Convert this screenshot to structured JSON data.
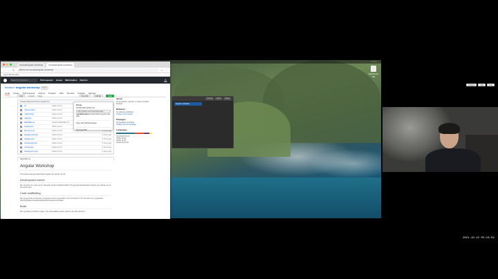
{
  "browser": {
    "tabs": [
      {
        "label": "tomiwa/angular-workshop"
      },
      {
        "label": "tomiwa/angular-workshop"
      }
    ],
    "url": "github.com/tomiwa/angular-workshop",
    "bookmarks": "Apps   Bookmarks"
  },
  "github": {
    "search_placeholder": "Search or jump to...",
    "nav": [
      "Pull requests",
      "Issues",
      "Marketplace",
      "Explore"
    ],
    "repo_owner": "tomiwa",
    "repo_name": "angular-workshop",
    "visibility": "Public",
    "tabs": [
      "Code",
      "Issues",
      "Pull requests",
      "Actions",
      "Projects",
      "Wiki",
      "Security",
      "Insights",
      "Settings"
    ],
    "actions": [
      "Unwatch",
      "Star",
      "Fork"
    ],
    "branch": "main",
    "branch_info": "1 branch",
    "tags_info": "0 tags",
    "goto_file": "Go to file",
    "add_file": "Add file",
    "code_button": "Code",
    "commit_message": "tomiwa Initial commit from Angular CLI",
    "files": [
      {
        "name": "src",
        "type": "dir",
        "msg": "Initial commit",
        "time": "6 hours ago"
      },
      {
        "name": ".browserslistrc",
        "type": "file",
        "msg": "Initial commit",
        "time": "6 hours ago"
      },
      {
        "name": ".editorconfig",
        "type": "file",
        "msg": "Initial commit",
        "time": "6 hours ago"
      },
      {
        "name": ".gitignore",
        "type": "file",
        "msg": "Initial commit",
        "time": "6 hours ago"
      },
      {
        "name": "README.md",
        "type": "file",
        "msg": "Updated README.md",
        "time": "6 hours ago"
      },
      {
        "name": "angular.json",
        "type": "file",
        "msg": "Initial commit",
        "time": "6 hours ago"
      },
      {
        "name": "karma.conf.js",
        "type": "file",
        "msg": "Initial commit",
        "time": "6 hours ago"
      },
      {
        "name": "package-lock.json",
        "type": "file",
        "msg": "Initial commit",
        "time": "6 hours ago"
      },
      {
        "name": "package.json",
        "type": "file",
        "msg": "Initial commit",
        "time": "6 hours ago"
      },
      {
        "name": "tsconfig.app.json",
        "type": "file",
        "msg": "Initial commit",
        "time": "6 hours ago"
      },
      {
        "name": "tsconfig.json",
        "type": "file",
        "msg": "Initial commit",
        "time": "6 hours ago"
      },
      {
        "name": "tsconfig.spec.json",
        "type": "file",
        "msg": "Initial commit",
        "time": "6 hours ago"
      }
    ],
    "readme_label": "README.md",
    "readme": {
      "title": "Angular Workshop",
      "intro": "This project was generated with Angular CLI version 12.2.8.",
      "dev_server_h": "Development server",
      "dev_server_p": "Run ng serve for a dev server. Navigate to http://localhost:4200/. The app will automatically reload if you change any of the source files.",
      "scaffold_h": "Code scaffolding",
      "scaffold_p": "Run ng generate component component-name to generate a new component. You can also use ng generate directive|pipe|service|class|guard|interface|enum|module.",
      "build_h": "Build",
      "build_p": "Run ng build to build the project. The build artifacts will be stored in the dist/ directory."
    },
    "clone": {
      "title": "Clone",
      "tabs": "HTTPS  SSH  GitHub CLI",
      "url": "https://github.com/tomiwa/angular-workshop.git",
      "hint": "Use Git or checkout with SVN using the web URL.",
      "desktop": "Open with GitHub Desktop",
      "zip": "Download ZIP"
    },
    "sidebar": {
      "about_h": "About",
      "about_p": "No description, website, or topics provided.",
      "readme": "Readme",
      "releases_h": "Releases",
      "releases_p": "No releases published",
      "releases_link": "Create a new release",
      "packages_h": "Packages",
      "packages_p": "No packages published",
      "packages_link": "Publish your first package",
      "languages_h": "Languages",
      "languages": [
        "TypeScript 52.1%",
        "HTML 26.3%",
        "SCSS 13.5%",
        "JavaScript 8.1%"
      ]
    }
  },
  "terminal": {
    "buttons": [
      "Cancel",
      "Open",
      "Share"
    ],
    "selected": "angular-workshop"
  },
  "desktop": {
    "icon_label": "Macintosh HD"
  },
  "timestamp": "2021-10-22 05:13:59"
}
